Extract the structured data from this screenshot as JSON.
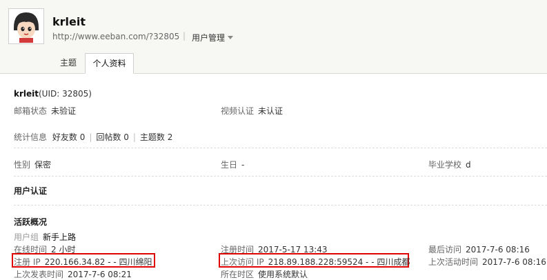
{
  "header": {
    "username": "krleit",
    "url": "http://www.eeban.com/?32805",
    "manage_label": "用户管理",
    "tabs": [
      {
        "label": "主题"
      },
      {
        "label": "个人资料"
      }
    ]
  },
  "profile": {
    "name": "krleit",
    "uid_text": "(UID: 32805)",
    "email_label": "邮箱状态",
    "email_value": "未验证",
    "video_label": "视频认证",
    "video_value": "未认证",
    "stats_label": "统计信息",
    "friends_label": "好友数",
    "friends_value": "0",
    "replies_label": "回帖数",
    "replies_value": "0",
    "threads_label": "主题数",
    "threads_value": "2",
    "gender_label": "性别",
    "gender_value": "保密",
    "birthday_label": "生日",
    "birthday_value": "-",
    "school_label": "毕业学校",
    "school_value": "d",
    "cert_title": "用户认证"
  },
  "activity": {
    "title": "活跃概况",
    "group_label": "用户组",
    "group_value": "新手上路",
    "online_label": "在线时间",
    "online_value": "2 小时",
    "reg_time_label": "注册时间",
    "reg_time_value": "2017-5-17 13:43",
    "last_visit_label": "最后访问",
    "last_visit_value": "2017-7-6 08:16",
    "reg_ip_label": "注册 IP",
    "reg_ip_value": "220.166.34.82 - - 四川绵阳",
    "last_ip_label": "上次访问 IP",
    "last_ip_value": "218.89.188.228:59524 - - 四川成都",
    "last_active_label": "上次活动时间",
    "last_active_value": "2017-7-6 08:16",
    "last_post_label": "上次发表时间",
    "last_post_value": "2017-7-6 08:21",
    "timezone_label": "所在时区",
    "timezone_value": "使用系统默认"
  }
}
